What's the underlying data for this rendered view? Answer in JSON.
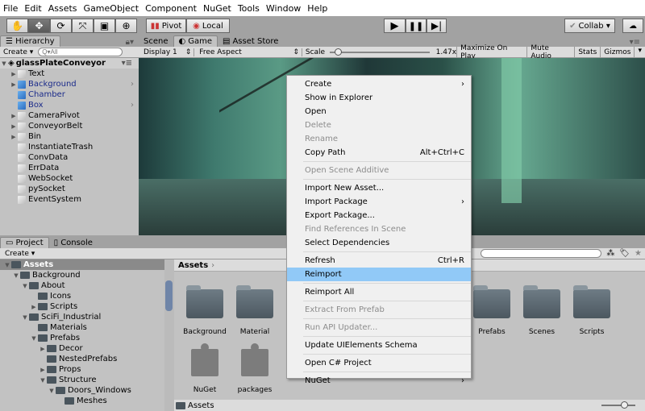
{
  "menubar": [
    "File",
    "Edit",
    "Assets",
    "GameObject",
    "Component",
    "NuGet",
    "Tools",
    "Window",
    "Help"
  ],
  "toolbar": {
    "pivot": "Pivot",
    "local": "Local",
    "collab": "Collab ▾",
    "tools": [
      "hand-tool",
      "move-tool",
      "rotate-tool",
      "scale-tool",
      "rect-tool",
      "transform-tool"
    ]
  },
  "hierarchy": {
    "tab": "Hierarchy",
    "create": "Create ▾",
    "search_placeholder": "Q▾All",
    "scene": "glassPlateConveyor",
    "items": [
      {
        "label": "Text",
        "arrow": true,
        "blue": false,
        "more": false
      },
      {
        "label": "Background",
        "arrow": true,
        "blue": true,
        "more": true
      },
      {
        "label": "Chamber",
        "arrow": false,
        "blue": true,
        "more": false
      },
      {
        "label": "Box",
        "arrow": false,
        "blue": true,
        "more": true
      },
      {
        "label": "CameraPivot",
        "arrow": true,
        "blue": false,
        "more": false
      },
      {
        "label": "ConveyorBelt",
        "arrow": true,
        "blue": false,
        "more": false
      },
      {
        "label": "Bin",
        "arrow": true,
        "blue": false,
        "more": false
      },
      {
        "label": "InstantiateTrash",
        "arrow": false,
        "blue": false,
        "more": false
      },
      {
        "label": "ConvData",
        "arrow": false,
        "blue": false,
        "more": false
      },
      {
        "label": "ErrData",
        "arrow": false,
        "blue": false,
        "more": false
      },
      {
        "label": "WebSocket",
        "arrow": false,
        "blue": false,
        "more": false
      },
      {
        "label": "pySocket",
        "arrow": false,
        "blue": false,
        "more": false
      },
      {
        "label": "EventSystem",
        "arrow": false,
        "blue": false,
        "more": false
      }
    ]
  },
  "game": {
    "tabs": [
      "Scene",
      "Game",
      "Asset Store"
    ],
    "display": "Display 1",
    "aspect": "Free Aspect",
    "scale_label": "Scale",
    "scale_value": "1.47x",
    "scale_fraction": 0.05,
    "buttons": [
      "Maximize On Play",
      "Mute Audio",
      "Stats",
      "Gizmos"
    ]
  },
  "project": {
    "tabs": [
      "Project",
      "Console"
    ],
    "create": "Create ▾",
    "breadcrumb": "Assets",
    "footer": "Assets",
    "tree": [
      {
        "label": "Assets",
        "depth": 0,
        "open": true
      },
      {
        "label": "Background",
        "depth": 1,
        "open": true
      },
      {
        "label": "About",
        "depth": 2,
        "open": true
      },
      {
        "label": "Icons",
        "depth": 3,
        "open": null
      },
      {
        "label": "Scripts",
        "depth": 3,
        "open": false
      },
      {
        "label": "SciFi_Industrial",
        "depth": 2,
        "open": true
      },
      {
        "label": "Materials",
        "depth": 3,
        "open": null
      },
      {
        "label": "Prefabs",
        "depth": 3,
        "open": true
      },
      {
        "label": "Decor",
        "depth": 4,
        "open": false
      },
      {
        "label": "NestedPrefabs",
        "depth": 4,
        "open": null
      },
      {
        "label": "Props",
        "depth": 4,
        "open": false
      },
      {
        "label": "Structure",
        "depth": 4,
        "open": true
      },
      {
        "label": "Doors_Windows",
        "depth": 5,
        "open": true
      },
      {
        "label": "Meshes",
        "depth": 6,
        "open": null
      }
    ],
    "assets": [
      {
        "label": "Background",
        "type": "folder"
      },
      {
        "label": "Material",
        "type": "folder"
      },
      {
        "label": "Prefabs",
        "type": "folder"
      },
      {
        "label": "Scenes",
        "type": "folder"
      },
      {
        "label": "Scripts",
        "type": "folder"
      },
      {
        "label": "NuGet",
        "type": "package"
      },
      {
        "label": "packages",
        "type": "package"
      }
    ]
  },
  "context_menu": [
    {
      "label": "Create",
      "sub": true
    },
    {
      "label": "Show in Explorer"
    },
    {
      "label": "Open"
    },
    {
      "label": "Delete",
      "disabled": true
    },
    {
      "label": "Rename",
      "disabled": true
    },
    {
      "label": "Copy Path",
      "shortcut": "Alt+Ctrl+C"
    },
    {
      "sep": true
    },
    {
      "label": "Open Scene Additive",
      "disabled": true
    },
    {
      "sep": true
    },
    {
      "label": "Import New Asset..."
    },
    {
      "label": "Import Package",
      "sub": true
    },
    {
      "label": "Export Package..."
    },
    {
      "label": "Find References In Scene",
      "disabled": true
    },
    {
      "label": "Select Dependencies"
    },
    {
      "sep": true
    },
    {
      "label": "Refresh",
      "shortcut": "Ctrl+R"
    },
    {
      "label": "Reimport",
      "highlighted": true
    },
    {
      "sep": true
    },
    {
      "label": "Reimport All"
    },
    {
      "sep": true
    },
    {
      "label": "Extract From Prefab",
      "disabled": true
    },
    {
      "sep": true
    },
    {
      "label": "Run API Updater...",
      "disabled": true
    },
    {
      "sep": true
    },
    {
      "label": "Update UIElements Schema"
    },
    {
      "sep": true
    },
    {
      "label": "Open C# Project"
    },
    {
      "sep": true
    },
    {
      "label": "NuGet",
      "sub": true
    }
  ]
}
